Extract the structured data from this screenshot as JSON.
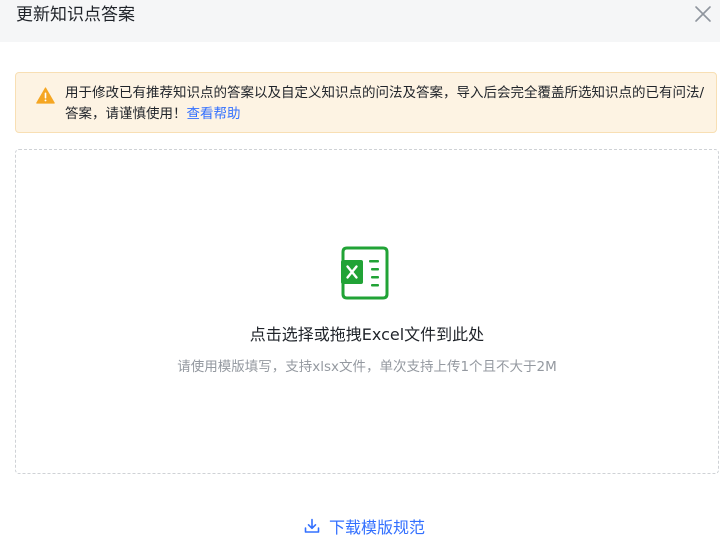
{
  "dialog": {
    "title": "更新知识点答案",
    "close_icon": "close-icon"
  },
  "alert": {
    "icon": "warning-icon",
    "icon_color": "#f5a623",
    "message": "用于修改已有推荐知识点的答案以及自定义知识点的问法及答案，导入后会完全覆盖所选知识点的已有问法/答案，请谨慎使用！",
    "link_text": "查看帮助",
    "link_color": "#3370ff"
  },
  "upload": {
    "icon": "excel-file-icon",
    "icon_color": "#21a336",
    "title": "点击选择或拖拽Excel文件到此处",
    "hint": "请使用模版填写，支持xlsx文件，单次支持上传1个且不大于2M"
  },
  "download": {
    "icon": "download-icon",
    "label": "下载模版规范"
  }
}
